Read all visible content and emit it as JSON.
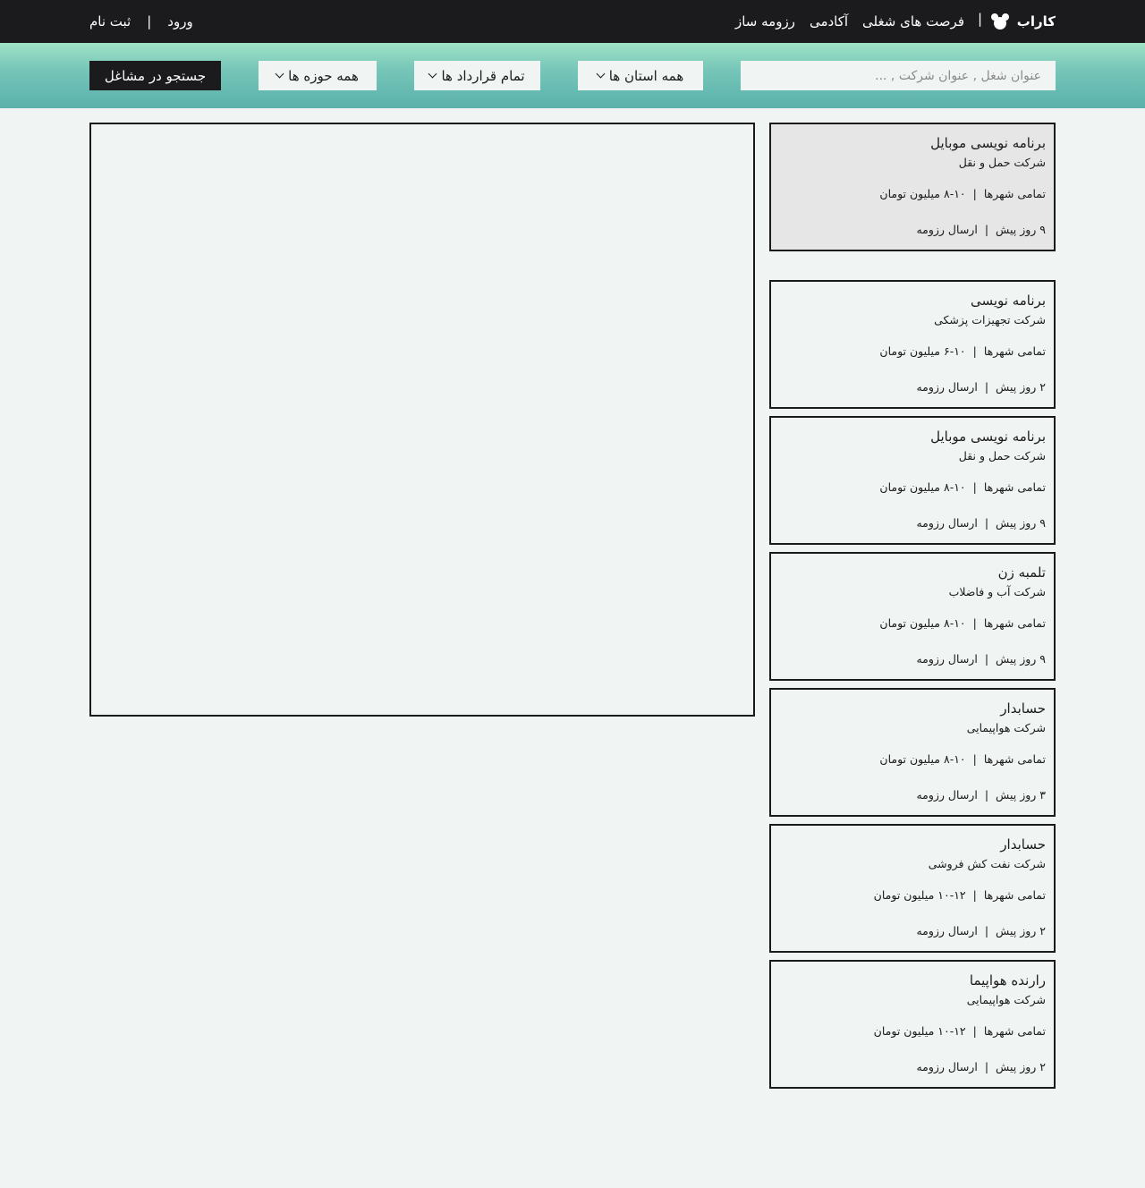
{
  "topbar": {
    "brand": "کاراب",
    "separator": "|",
    "nav": [
      "فرصت های شغلی",
      "آکادمی",
      "رزومه ساز"
    ],
    "login": "ورود",
    "register": "ثبت نام"
  },
  "search": {
    "placeholder": "عنوان شغل , عنوان شرکت , ...",
    "province": "همه استان ها",
    "contract": "تمام قرارداد ها",
    "field": "همه حوزه ها",
    "button": "جستجو در مشاغل"
  },
  "jobs": [
    {
      "title": "برنامه نویسی موبایل",
      "company": "شرکت حمل و نقل",
      "location": "تمامی شهرها",
      "salary": "۸-۱۰ میلیون تومان",
      "posted": "۹ روز پیش",
      "action": "ارسال رزومه",
      "selected": true
    },
    {
      "title": "برنامه نویسی",
      "company": "شرکت تجهیزات پزشکی",
      "location": "تمامی شهرها",
      "salary": "۶-۱۰ میلیون تومان",
      "posted": "۲ روز پیش",
      "action": "ارسال رزومه"
    },
    {
      "title": "برنامه نویسی موبایل",
      "company": "شرکت حمل و نقل",
      "location": "تمامی شهرها",
      "salary": "۸-۱۰ میلیون تومان",
      "posted": "۹ روز پیش",
      "action": "ارسال رزومه"
    },
    {
      "title": "تلمبه زن",
      "company": "شرکت آب و فاضلاب",
      "location": "تمامی شهرها",
      "salary": "۸-۱۰ میلیون تومان",
      "posted": "۹ روز پیش",
      "action": "ارسال رزومه"
    },
    {
      "title": "حسابدار",
      "company": "شرکت هواپیمایی",
      "location": "تمامی شهرها",
      "salary": "۸-۱۰ میلیون تومان",
      "posted": "۳ روز پیش",
      "action": "ارسال رزومه"
    },
    {
      "title": "حسابدار",
      "company": "شرکت نفت کش فروشی",
      "location": "تمامی شهرها",
      "salary": "۱۰-۱۲ میلیون تومان",
      "posted": "۲ روز پیش",
      "action": "ارسال رزومه"
    },
    {
      "title": "رارنده هواپیما",
      "company": "شرکت هواپیمایی",
      "location": "تمامی شهرها",
      "salary": "۱۰-۱۲ میلیون تومان",
      "posted": "۲ روز پیش",
      "action": "ارسال رزومه"
    }
  ]
}
